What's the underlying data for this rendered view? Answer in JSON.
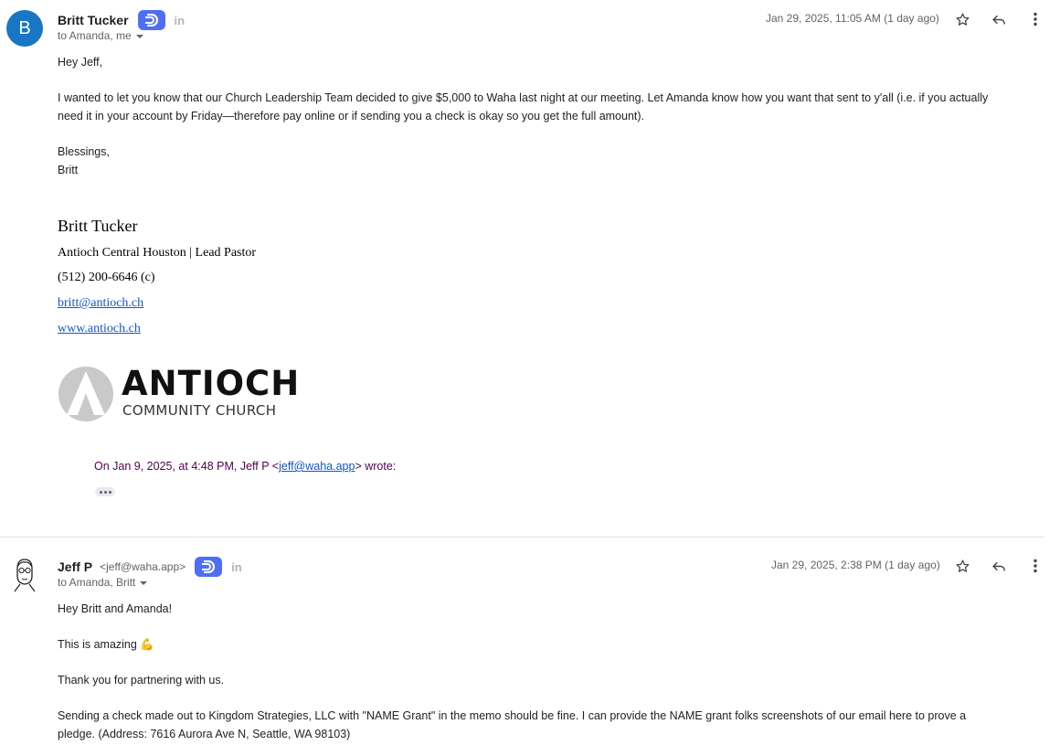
{
  "msg1": {
    "avatar_letter": "B",
    "sender_name": "Britt Tucker",
    "recipients": "to Amanda, me",
    "date": "Jan 29, 2025, 11:05 AM (1 day ago)",
    "greeting": "Hey Jeff,",
    "para1_line1": "I wanted to let you know that our Church Leadership Team decided to give $5,000 to Waha last night at our meeting. Let Amanda know how you want that sent to y'all (i.e. if you actually",
    "para1_line2": "need it in your account by Friday—therefore pay online or if sending you a check is okay so you get the full amount).",
    "closing1": "Blessings,",
    "closing2": "Britt",
    "signature": {
      "name": "Britt Tucker",
      "title": "Antioch Central Houston | Lead Pastor",
      "phone": "(512) 200-6646 (c)",
      "email": "britt@antioch.ch",
      "website": "www.antioch.ch",
      "logo_word": "ANTIOCH",
      "logo_sub": "COMMUNITY CHURCH"
    },
    "quote_prefix": "On Jan 9, 2025, at 4:48 PM, Jeff P <",
    "quote_email": "jeff@waha.app",
    "quote_suffix": "> wrote:"
  },
  "msg2": {
    "sender_name": "Jeff P",
    "sender_email": "<jeff@waha.app>",
    "recipients": "to Amanda, Britt",
    "date": "Jan 29, 2025, 2:38 PM (1 day ago)",
    "greeting": "Hey Britt and Amanda!",
    "line2": "This is amazing 💪",
    "line3": "Thank you for partnering with us.",
    "para_line1": "Sending a check made out to Kingdom Strategies, LLC with \"NAME Grant\" in the memo should be fine. I can provide the NAME grant folks screenshots of our email here to prove a",
    "para_line2": "pledge. (Address: 7616 Aurora Ave N, Seattle, WA 98103)"
  },
  "icons": {
    "star": "star-icon",
    "reply": "reply-icon",
    "more": "more-vert-icon",
    "linkedin": "linkedin-icon",
    "badge": "d-badge-icon",
    "li_text": "in"
  },
  "colors": {
    "avatar_bg": "#1976c5",
    "badge_bg": "#4f6ef7",
    "link": "#1155cc",
    "quote": "#500050"
  }
}
